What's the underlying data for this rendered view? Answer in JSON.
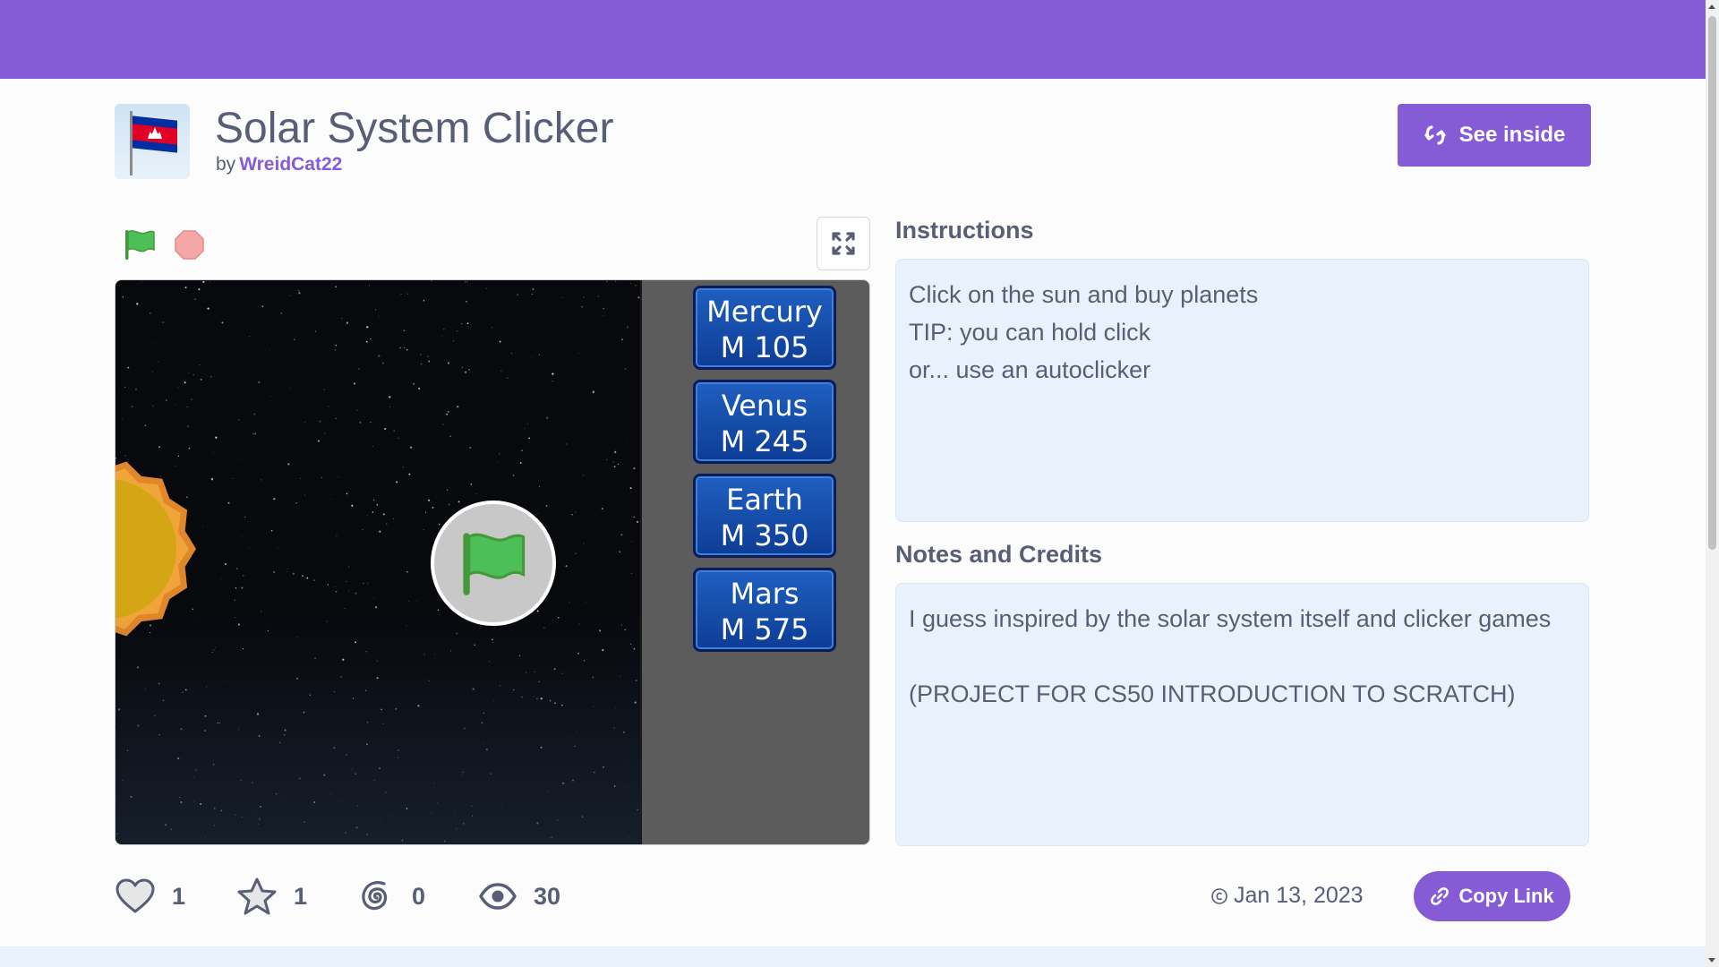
{
  "project": {
    "title": "Solar System Clicker",
    "by_label": "by",
    "author": "WreidCat22",
    "see_inside_label": "See inside"
  },
  "instructions": {
    "heading": "Instructions",
    "lines": [
      "Click on the sun and buy planets",
      "TIP: you can hold click",
      "or... use an autoclicker"
    ]
  },
  "notes": {
    "heading": "Notes and Credits",
    "line1": "I guess inspired by the solar system itself and clicker games",
    "line2": "(PROJECT FOR CS50 INTRODUCTION TO SCRATCH)"
  },
  "stage": {
    "planets": [
      {
        "name": "Mercury",
        "cost": "M 105"
      },
      {
        "name": "Venus",
        "cost": "M 245"
      },
      {
        "name": "Earth",
        "cost": "M 350"
      },
      {
        "name": "Mars",
        "cost": "M 575"
      }
    ]
  },
  "stats": {
    "loves": "1",
    "favorites": "1",
    "remixes": "0",
    "views": "30"
  },
  "footer": {
    "date": "Jan 13, 2023",
    "copy_link_label": "Copy Link"
  },
  "icons": {
    "flag": "green-flag-icon",
    "stop": "stop-icon",
    "fullscreen": "fullscreen-icon",
    "see_inside": "remix-arrows-icon",
    "heart": "heart-icon",
    "star": "star-icon",
    "remix": "remix-spiral-icon",
    "views": "eye-icon",
    "date": "copyright-icon",
    "link": "link-icon"
  },
  "colors": {
    "brand_purple": "#855cd6",
    "text": "#575e75",
    "panel_bg": "#e9f1fc",
    "flag_green": "#4cbf56",
    "stop_red": "#ec9c9c",
    "planet_button": "#1f5fbf"
  }
}
